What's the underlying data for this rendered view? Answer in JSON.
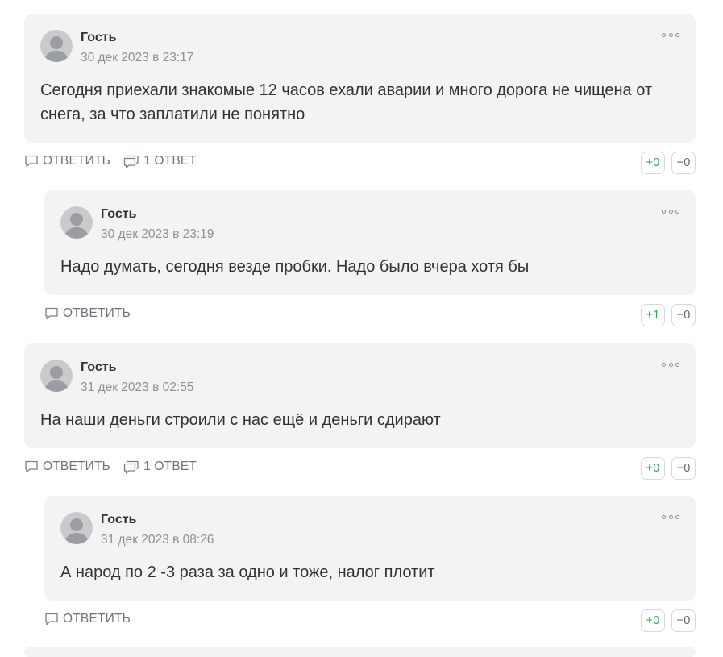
{
  "comments": [
    {
      "author": "Гость",
      "date": "30 дек 2023 в 23:17",
      "text": "Сегодня приехали знакомые 12 часов ехали аварии и много дорога не чищена от снега, за что заплатили не понятно",
      "reply_label": "ОТВЕТИТЬ",
      "replies_label": "1 ОТВЕТ",
      "plus": "+0",
      "minus": "−0"
    },
    {
      "author": "Гость",
      "date": "30 дек 2023 в 23:19",
      "text": "Надо думать, сегодня везде пробки. Надо было вчера хотя бы",
      "reply_label": "ОТВЕТИТЬ",
      "plus": "+1",
      "minus": "−0"
    },
    {
      "author": "Гость",
      "date": "31 дек 2023 в 02:55",
      "text": "На наши деньги строили с нас ещё и деньги сдирают",
      "reply_label": "ОТВЕТИТЬ",
      "replies_label": "1 ОТВЕТ",
      "plus": "+0",
      "minus": "−0"
    },
    {
      "author": "Гость",
      "date": "31 дек 2023 в 08:26",
      "text": "А народ по 2 -3 раза за одно и тоже, налог плотит",
      "reply_label": "ОТВЕТИТЬ",
      "plus": "+0",
      "minus": "−0"
    }
  ],
  "icons": {
    "avatar": "user-silhouette-icon",
    "more": "more-dots-icon",
    "reply": "speech-bubble-icon",
    "replies": "double-speech-bubble-icon"
  },
  "colors": {
    "card_bg": "#f3f3f4",
    "vote_plus": "#2fa84f",
    "muted_text": "#6e737a"
  }
}
